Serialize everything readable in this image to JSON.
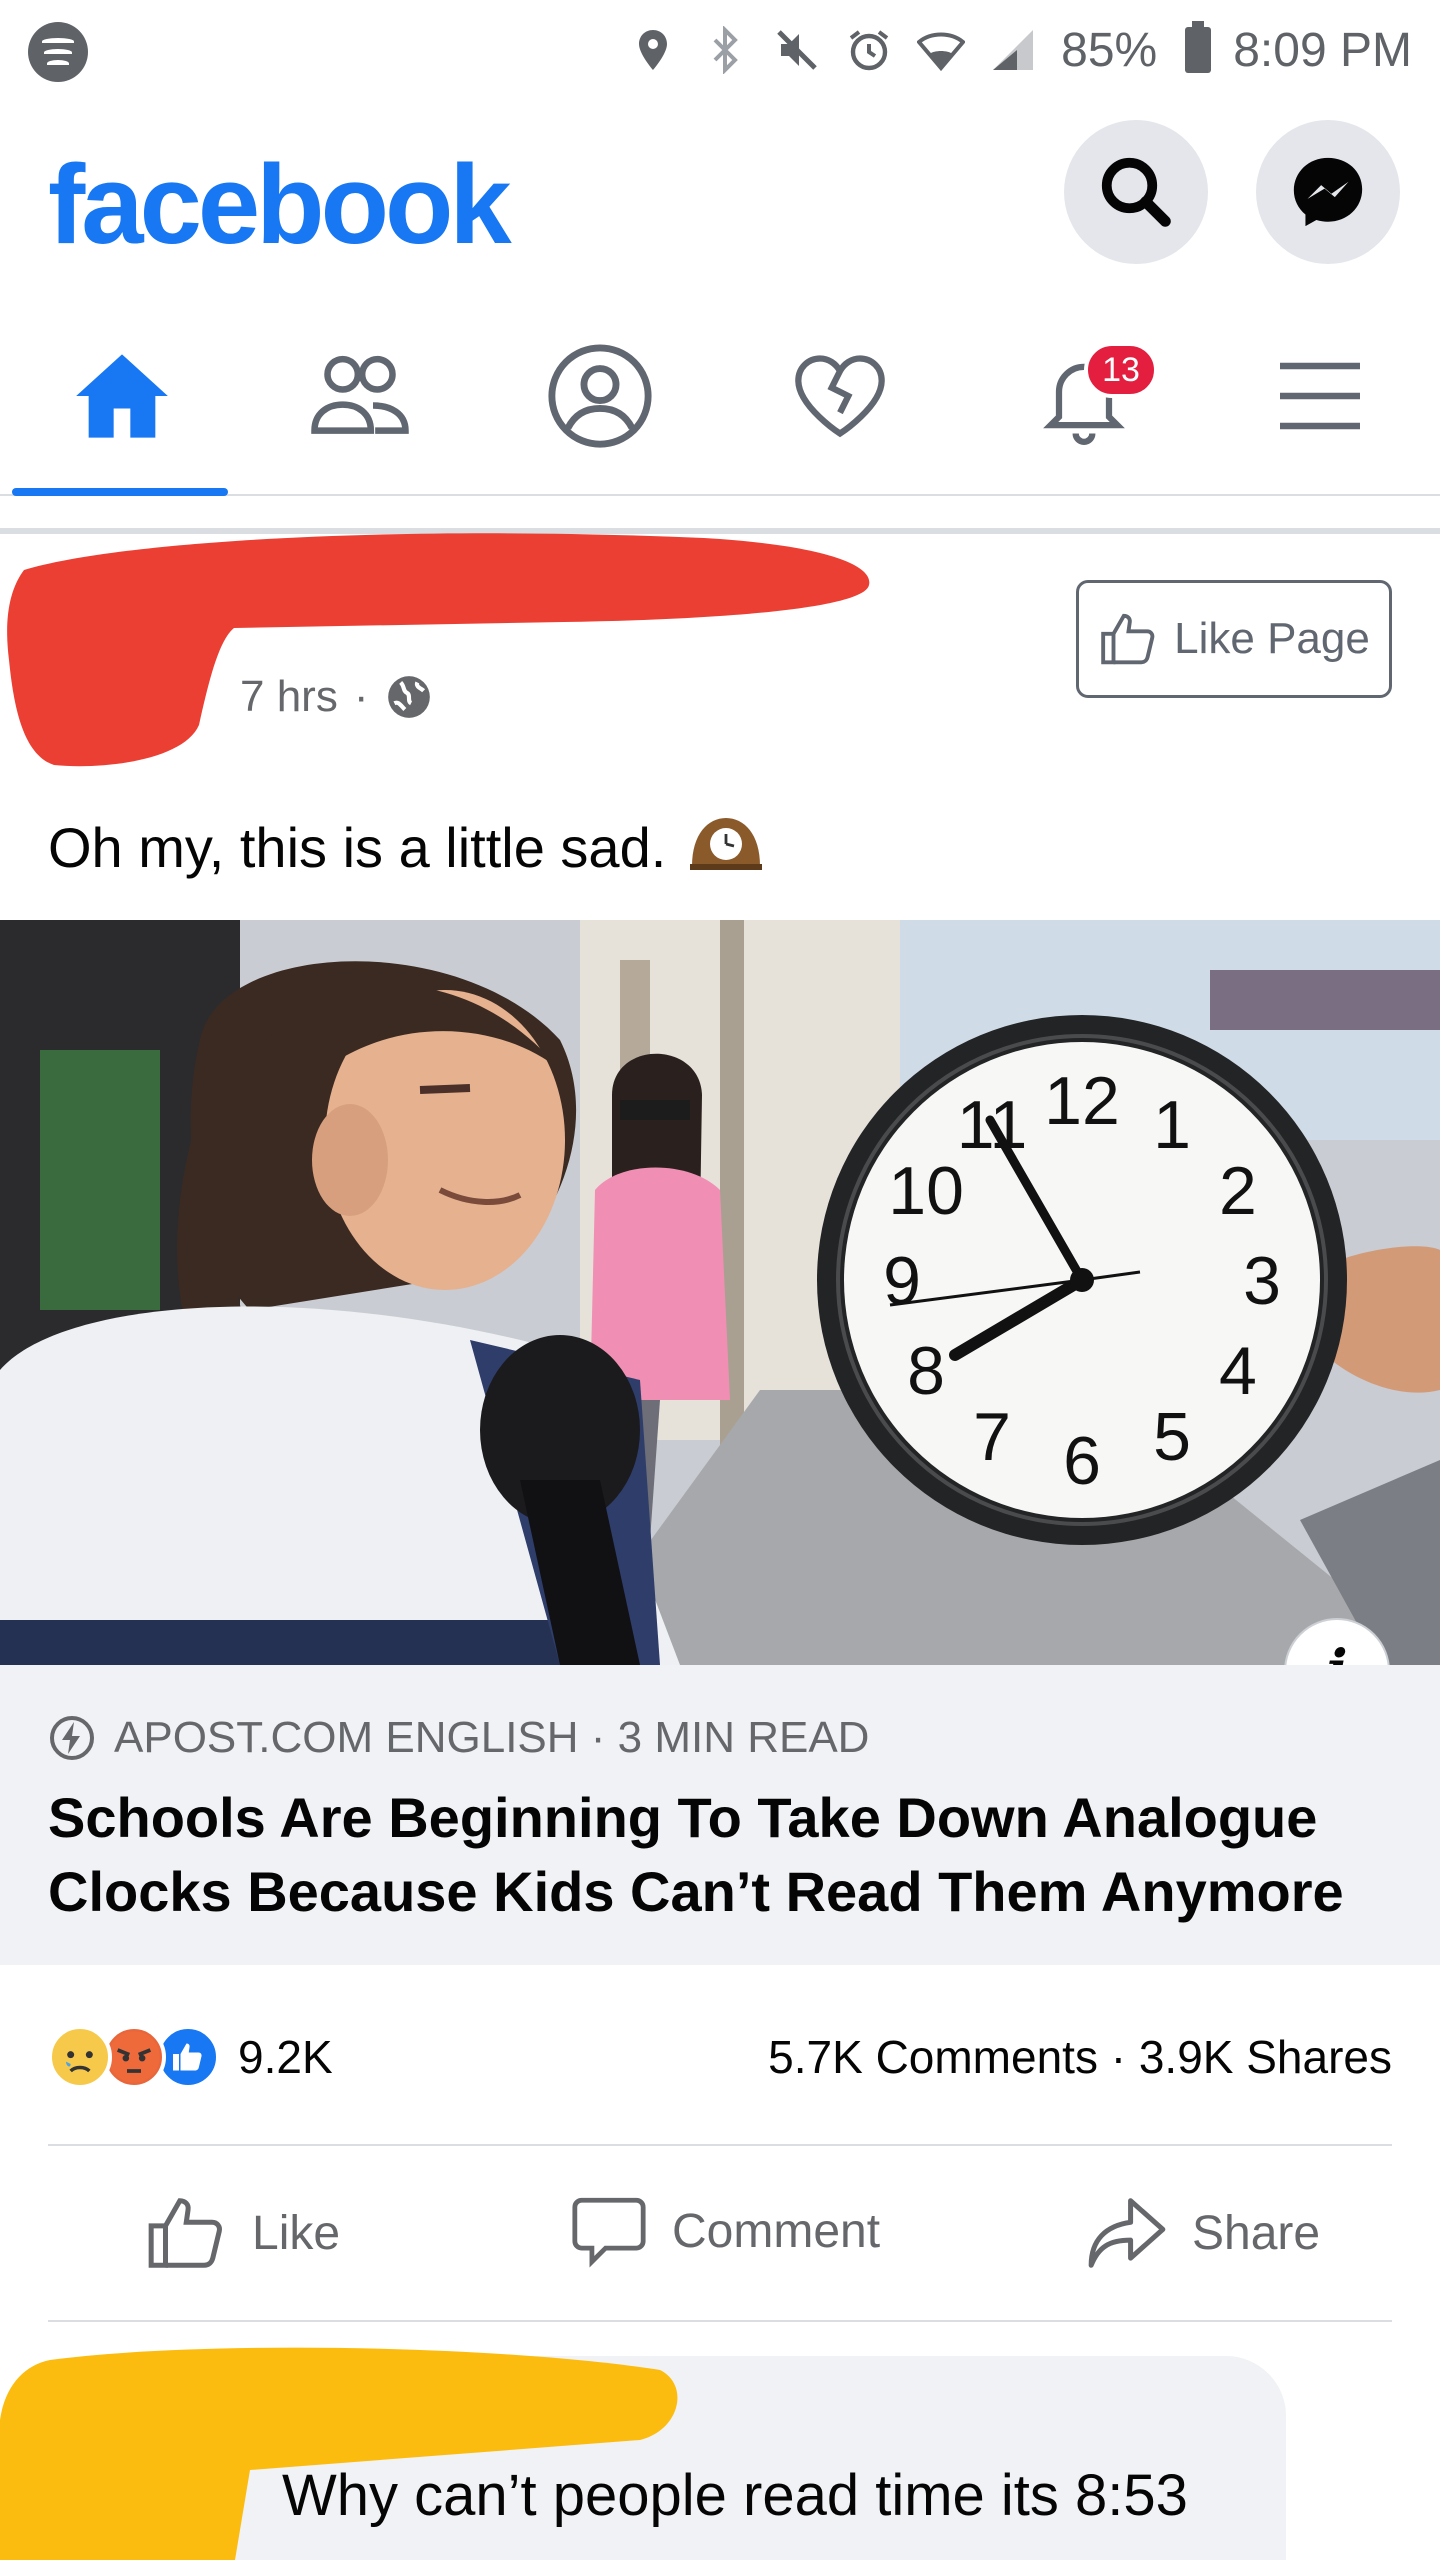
{
  "status_bar": {
    "battery": "85%",
    "time": "8:09 PM",
    "icons": [
      "spotify-icon",
      "location-icon",
      "bluetooth-icon",
      "mute-icon",
      "alarm-icon",
      "wifi-icon",
      "signal-icon",
      "battery-icon"
    ]
  },
  "header": {
    "logo": "facebook",
    "brand_color": "#1877f2",
    "search_icon": "search-icon",
    "messenger_icon": "messenger-icon"
  },
  "tabs": {
    "items": [
      "home",
      "friends",
      "profile",
      "dating",
      "notifications",
      "menu"
    ],
    "active": "home",
    "notification_badge": "13"
  },
  "post": {
    "timestamp": "7 hrs",
    "separator": "·",
    "privacy_icon": "globe-icon",
    "like_page_label": "Like Page",
    "text": "Oh my, this is a little sad.",
    "text_emoji": "🕰",
    "link": {
      "source": "APOST.COM ENGLISH · 3 MIN READ",
      "title": "Schools Are Beginning To Take Down Analogue Clocks Because Kids Can’t Read Them Anymore",
      "info_label": "i"
    },
    "clock_numbers": [
      "12",
      "1",
      "2",
      "3",
      "4",
      "5",
      "6",
      "7",
      "8",
      "9",
      "10",
      "11"
    ],
    "reactions": {
      "types": [
        "sad",
        "angry",
        "like"
      ],
      "count": "9.2K"
    },
    "counts": "5.7K Comments · 3.9K Shares",
    "actions": {
      "like": "Like",
      "comment": "Comment",
      "share": "Share"
    }
  },
  "comment": {
    "text": "Why can’t people read time its 8:53"
  }
}
